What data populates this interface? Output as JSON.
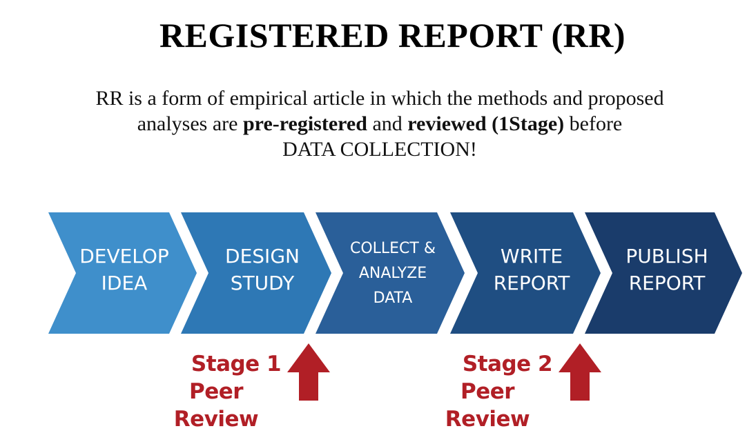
{
  "title": "REGISTERED REPORT (RR)",
  "description": {
    "line1": "RR is a form of empirical article in which the methods and proposed",
    "line2_a": "analyses are ",
    "line2_b": "pre-registered",
    "line2_c": " and ",
    "line2_d": "reviewed (1Stage)",
    "line2_e": " before",
    "line3": "DATA COLLECTION!"
  },
  "steps": [
    {
      "line1": "DEVELOP",
      "line2": "IDEA",
      "color": "#3f8fcb"
    },
    {
      "line1": "DESIGN",
      "line2": "STUDY",
      "color": "#2e78b5"
    },
    {
      "line1": "COLLECT &",
      "line2": "ANALYZE",
      "line3": "DATA",
      "color": "#2a5f99"
    },
    {
      "line1": "WRITE",
      "line2": "REPORT",
      "color": "#1f4e82"
    },
    {
      "line1": "PUBLISH",
      "line2": "REPORT",
      "color": "#1a3c6b"
    }
  ],
  "reviews": [
    {
      "line1": "Stage 1",
      "line2": "Peer Review"
    },
    {
      "line1": "Stage 2",
      "line2": "Peer Review"
    }
  ],
  "arrow_color": "#b11f26"
}
